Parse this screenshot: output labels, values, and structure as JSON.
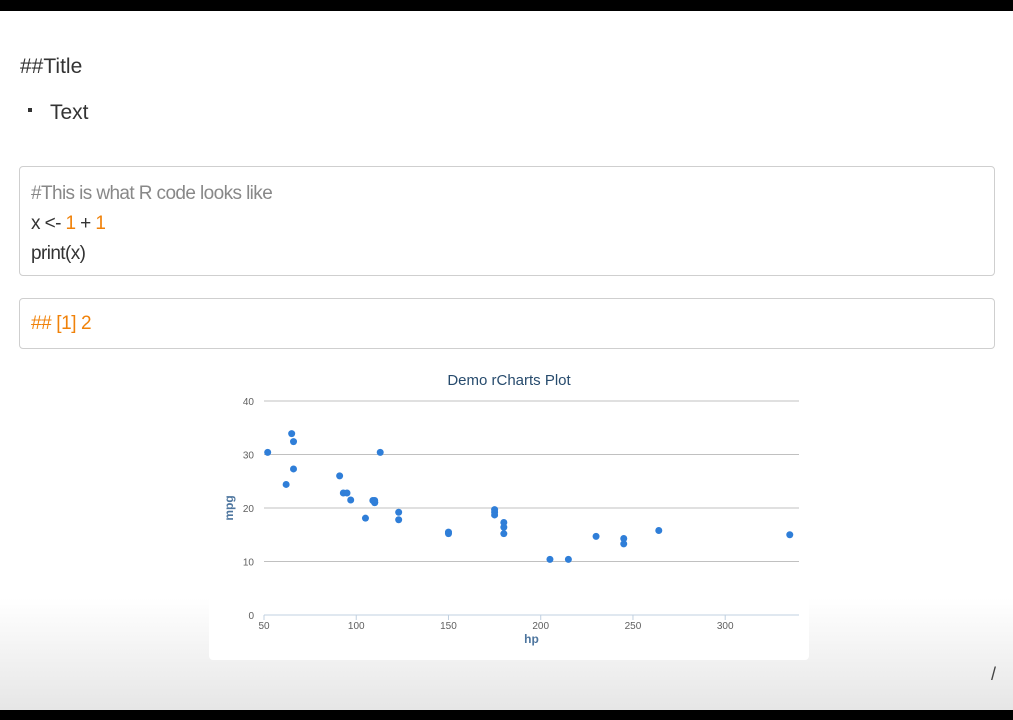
{
  "slide": {
    "title": "##Title",
    "bullets": [
      "Text"
    ]
  },
  "code_block": {
    "comment": "#This is what R code looks like",
    "line2_prefix": "x <- ",
    "line2_num1": "1",
    "line2_op": " + ",
    "line2_num2": "1",
    "line3": "print(x)"
  },
  "output_block": {
    "text": "## [1] 2"
  },
  "colors": {
    "accent": "#f0820a",
    "point": "#2f7ed8",
    "axis_title": "#4d759e",
    "title": "#274b6d"
  },
  "chart_data": {
    "type": "scatter",
    "title": "Demo rCharts Plot",
    "xlabel": "hp",
    "ylabel": "mpg",
    "xlim": [
      50,
      340
    ],
    "ylim": [
      0,
      40
    ],
    "xticks": [
      50,
      100,
      150,
      200,
      250,
      300
    ],
    "yticks": [
      0,
      10,
      20,
      30,
      40
    ],
    "grid": true,
    "points": [
      {
        "x": 110,
        "y": 21.0
      },
      {
        "x": 110,
        "y": 21.0
      },
      {
        "x": 93,
        "y": 22.8
      },
      {
        "x": 110,
        "y": 21.4
      },
      {
        "x": 175,
        "y": 18.7
      },
      {
        "x": 105,
        "y": 18.1
      },
      {
        "x": 245,
        "y": 14.3
      },
      {
        "x": 62,
        "y": 24.4
      },
      {
        "x": 95,
        "y": 22.8
      },
      {
        "x": 123,
        "y": 19.2
      },
      {
        "x": 123,
        "y": 17.8
      },
      {
        "x": 180,
        "y": 16.4
      },
      {
        "x": 180,
        "y": 17.3
      },
      {
        "x": 180,
        "y": 15.2
      },
      {
        "x": 205,
        "y": 10.4
      },
      {
        "x": 215,
        "y": 10.4
      },
      {
        "x": 230,
        "y": 14.7
      },
      {
        "x": 66,
        "y": 32.4
      },
      {
        "x": 52,
        "y": 30.4
      },
      {
        "x": 65,
        "y": 33.9
      },
      {
        "x": 97,
        "y": 21.5
      },
      {
        "x": 150,
        "y": 15.5
      },
      {
        "x": 150,
        "y": 15.2
      },
      {
        "x": 245,
        "y": 13.3
      },
      {
        "x": 175,
        "y": 19.2
      },
      {
        "x": 66,
        "y": 27.3
      },
      {
        "x": 91,
        "y": 26.0
      },
      {
        "x": 113,
        "y": 30.4
      },
      {
        "x": 264,
        "y": 15.8
      },
      {
        "x": 175,
        "y": 19.7
      },
      {
        "x": 335,
        "y": 15.0
      },
      {
        "x": 109,
        "y": 21.4
      }
    ]
  },
  "page_marker": "/"
}
